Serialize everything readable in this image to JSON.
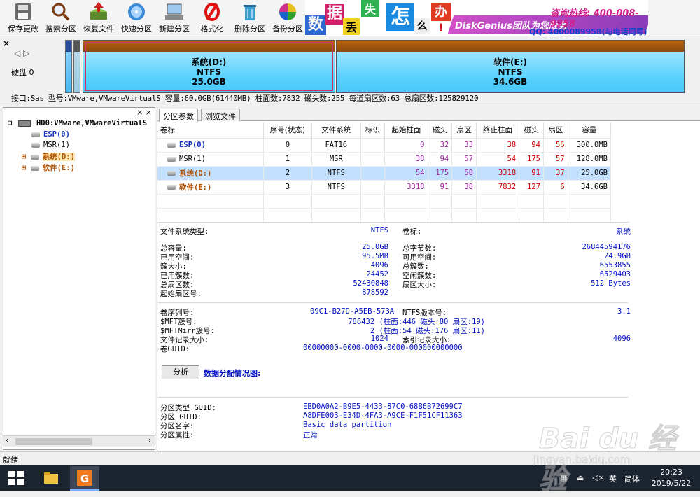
{
  "toolbar": {
    "buttons": [
      {
        "label": "保存更改",
        "icon": "save-icon"
      },
      {
        "label": "搜索分区",
        "icon": "magnifier-icon"
      },
      {
        "label": "恢复文件",
        "icon": "recover-icon"
      },
      {
        "label": "快速分区",
        "icon": "disk-icon"
      },
      {
        "label": "新建分区",
        "icon": "new-partition-icon"
      },
      {
        "label": "格式化",
        "icon": "format-icon"
      },
      {
        "label": "删除分区",
        "icon": "trash-icon"
      },
      {
        "label": "备份分区",
        "icon": "backup-icon"
      }
    ]
  },
  "banner": {
    "chars": [
      "数",
      "据",
      "丢",
      "失",
      "怎",
      "么",
      "办",
      "!"
    ],
    "phone": "咨询热线: 400-008-9958",
    "brand": "DiskGenius团队为您服务",
    "qq": "QQ: 4000089958(与电话同号)"
  },
  "diskbar": {
    "disk_label": "硬盘 0",
    "partitions": [
      {
        "name": "系统(D:)",
        "fs": "NTFS",
        "size": "25.0GB"
      },
      {
        "name": "软件(E:)",
        "fs": "NTFS",
        "size": "34.6GB"
      }
    ],
    "info": "接口:Sas  型号:VMware,VMwareVirtualS  容量:60.0GB(61440MB)  柱面数:7832  磁头数:255  每道扇区数:63  总扇区数:125829120"
  },
  "tree": {
    "root": "HD0:VMware,VMwareVirtualS",
    "items": [
      "ESP(0)",
      "MSR(1)",
      "系统(D:)",
      "软件(E:)"
    ]
  },
  "tabs": [
    "分区参数",
    "浏览文件"
  ],
  "table": {
    "headers": [
      "卷标",
      "序号(状态)",
      "文件系统",
      "标识",
      "起始柱面",
      "磁头",
      "扇区",
      "终止柱面",
      "磁头",
      "扇区",
      "容量"
    ],
    "rows": [
      {
        "name": "ESP(0)",
        "idx": "0",
        "fs": "FAT16",
        "flag": "",
        "sc": "0",
        "sh": "32",
        "ss": "33",
        "ec": "38",
        "eh": "94",
        "es": "56",
        "cap": "300.0MB"
      },
      {
        "name": "MSR(1)",
        "idx": "1",
        "fs": "MSR",
        "flag": "",
        "sc": "38",
        "sh": "94",
        "ss": "57",
        "ec": "54",
        "eh": "175",
        "es": "57",
        "cap": "128.0MB"
      },
      {
        "name": "系统(D:)",
        "idx": "2",
        "fs": "NTFS",
        "flag": "",
        "sc": "54",
        "sh": "175",
        "ss": "58",
        "ec": "3318",
        "eh": "91",
        "es": "37",
        "cap": "25.0GB"
      },
      {
        "name": "软件(E:)",
        "idx": "3",
        "fs": "NTFS",
        "flag": "",
        "sc": "3318",
        "sh": "91",
        "ss": "38",
        "ec": "7832",
        "eh": "127",
        "es": "6",
        "cap": "34.6GB"
      }
    ]
  },
  "details": {
    "fs_type_k": "文件系统类型:",
    "fs_type_v": "NTFS",
    "vol_label_k": "卷标:",
    "vol_label_v": "系统",
    "left1": [
      {
        "k": "总容量:",
        "v": "25.0GB"
      },
      {
        "k": "已用空间:",
        "v": "95.5MB"
      },
      {
        "k": "簇大小:",
        "v": "4096"
      },
      {
        "k": "已用簇数:",
        "v": "24452"
      },
      {
        "k": "总扇区数:",
        "v": "52430848"
      },
      {
        "k": "起始扇区号:",
        "v": "878592"
      }
    ],
    "right1": [
      {
        "k": "总字节数:",
        "v": "26844594176"
      },
      {
        "k": "可用空间:",
        "v": "24.9GB"
      },
      {
        "k": "总簇数:",
        "v": "6553855"
      },
      {
        "k": "空闲簇数:",
        "v": "6529403"
      },
      {
        "k": "扇区大小:",
        "v": "512 Bytes"
      }
    ],
    "serial_k": "卷序列号:",
    "serial_v": "09C1-B27D-A5EB-573A",
    "ntfs_ver_k": "NTFS版本号:",
    "ntfs_ver_v": "3.1",
    "mft_k": "$MFT簇号:",
    "mft_v": "786432 (柱面:446 磁头:80 扇区:19)",
    "mftm_k": "$MFTMirr簇号:",
    "mftm_v": "2 (柱面:54 磁头:176 扇区:11)",
    "frs_k": "文件记录大小:",
    "frs_v": "1024",
    "idx_k": "索引记录大小:",
    "idx_v": "4096",
    "guid_k": "卷GUID:",
    "guid_v": "00000000-0000-0000-0000-000000000000",
    "analyze": "分析",
    "dist": "数据分配情况图:",
    "ptype_k": "分区类型 GUID:",
    "ptype_v": "EBD0A0A2-B9E5-4433-87C0-68B6B72699C7",
    "pguid_k": "分区 GUID:",
    "pguid_v": "A8DFE003-E34D-4FA3-A9CE-F1F51CF11363",
    "pname_k": "分区名字:",
    "pname_v": "Basic data partition",
    "pattr_k": "分区属性:",
    "pattr_v": "正常"
  },
  "status": "就绪",
  "taskbar": {
    "lang": "英",
    "ime": "简体",
    "time": "20:23",
    "date": "2019/5/22"
  },
  "watermark": {
    "text": "Bai du 经验",
    "url": "jingyan.baidu.com"
  }
}
